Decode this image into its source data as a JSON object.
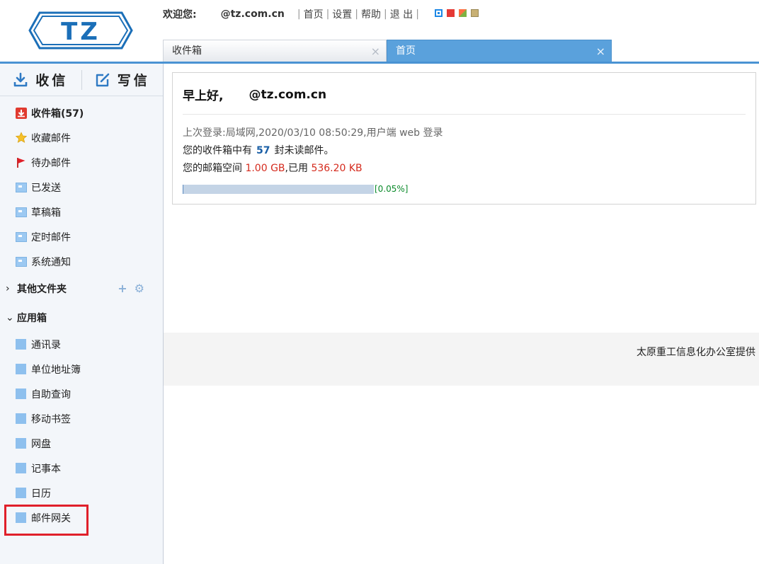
{
  "header": {
    "logo_text": "TZ",
    "greeting": "欢迎您:",
    "account": "@tz.com.cn",
    "links": [
      "首页",
      "设置",
      "帮助",
      "退 出"
    ],
    "skins": [
      {
        "name": "blue",
        "color": "#1e88e5"
      },
      {
        "name": "red",
        "color": "#e53935"
      },
      {
        "name": "orange-green",
        "color": "#ff7043"
      },
      {
        "name": "khaki",
        "color": "#c8b074"
      }
    ]
  },
  "tabs": [
    {
      "label": "收件箱",
      "active": false
    },
    {
      "label": "首页",
      "active": true
    }
  ],
  "close_glyph": "×",
  "sidebar": {
    "receive_label": "收信",
    "compose_label": "写信",
    "folders": [
      {
        "label": "收件箱(57)",
        "icon": "inbox-icon",
        "bold": true
      },
      {
        "label": "收藏邮件",
        "icon": "star-icon"
      },
      {
        "label": "待办邮件",
        "icon": "flag-icon"
      },
      {
        "label": "已发送",
        "icon": "folder-icon"
      },
      {
        "label": "草稿箱",
        "icon": "folder-icon"
      },
      {
        "label": "定时邮件",
        "icon": "folder-icon"
      },
      {
        "label": "系统通知",
        "icon": "folder-icon"
      }
    ],
    "other_folders": {
      "label": "其他文件夹",
      "chevron": "›",
      "add_glyph": "+",
      "settings_glyph": "⚙"
    },
    "apps": {
      "label": "应用箱",
      "chevron": "⌄",
      "items": [
        "通讯录",
        "单位地址簿",
        "自助查询",
        "移动书签",
        "网盘",
        "记事本",
        "日历",
        "邮件网关"
      ],
      "highlighted": "邮件网关"
    }
  },
  "main": {
    "greeting": "早上好,",
    "account": "@tz.com.cn",
    "last_login": "上次登录:局域网,2020/03/10 08:50:29,用户端 web 登录",
    "unread_prefix": "您的收件箱中有",
    "unread_count": "57",
    "unread_suffix": "封未读邮件。",
    "quota_prefix": "您的邮箱空间",
    "quota_total": "1.00 GB",
    "quota_mid": ",已用",
    "quota_used": "536.20 KB",
    "quota_fraction": 0.0005,
    "quota_pct_label": "[0.05%]",
    "footer": "太原重工信息化办公室提供"
  },
  "colors": {
    "accent": "#4a93d3",
    "tab_active": "#5aa1dc",
    "app_icon": "#8ec0ee",
    "highlight_box": "#e0202a",
    "unread_number": "#1a5fa6",
    "quota_red": "#d52b1e",
    "quota_green": "#0a8a2a"
  }
}
